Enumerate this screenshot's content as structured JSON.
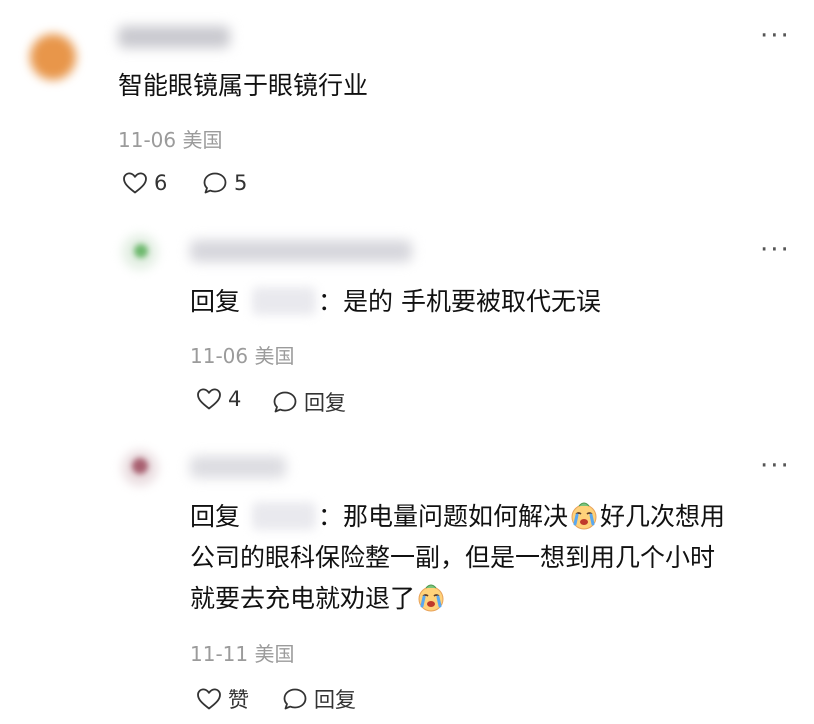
{
  "comments": [
    {
      "text": "智能眼镜属于眼镜行业",
      "date": "11-06",
      "location": "美国",
      "like_count": "6",
      "reply_count": "5"
    },
    {
      "reply_prefix": "回复",
      "text": "：是的 手机要被取代无误",
      "date": "11-06",
      "location": "美国",
      "like_count": "4",
      "reply_label": "回复"
    },
    {
      "reply_prefix": "回复",
      "text_line1_a": "：那电量问题如何解决",
      "text_line1_b": "好几次想用",
      "text_line2": "公司的眼科保险整一副，但是一想到用几个小时",
      "text_line3": "就要去充电就劝退了",
      "date": "11-11",
      "location": "美国",
      "like_label": "赞",
      "reply_label": "回复"
    }
  ],
  "more_label": "···",
  "icons": {
    "like": "heart-outline-icon",
    "comment": "speech-bubble-icon",
    "emoji": "crying-face-emoji"
  },
  "colors": {
    "meta": "#9b9b9b",
    "text": "#111111",
    "accent_avatar_1": "#e89a4a",
    "accent_avatar_2": "#6db86d",
    "accent_avatar_3": "#a86070"
  }
}
